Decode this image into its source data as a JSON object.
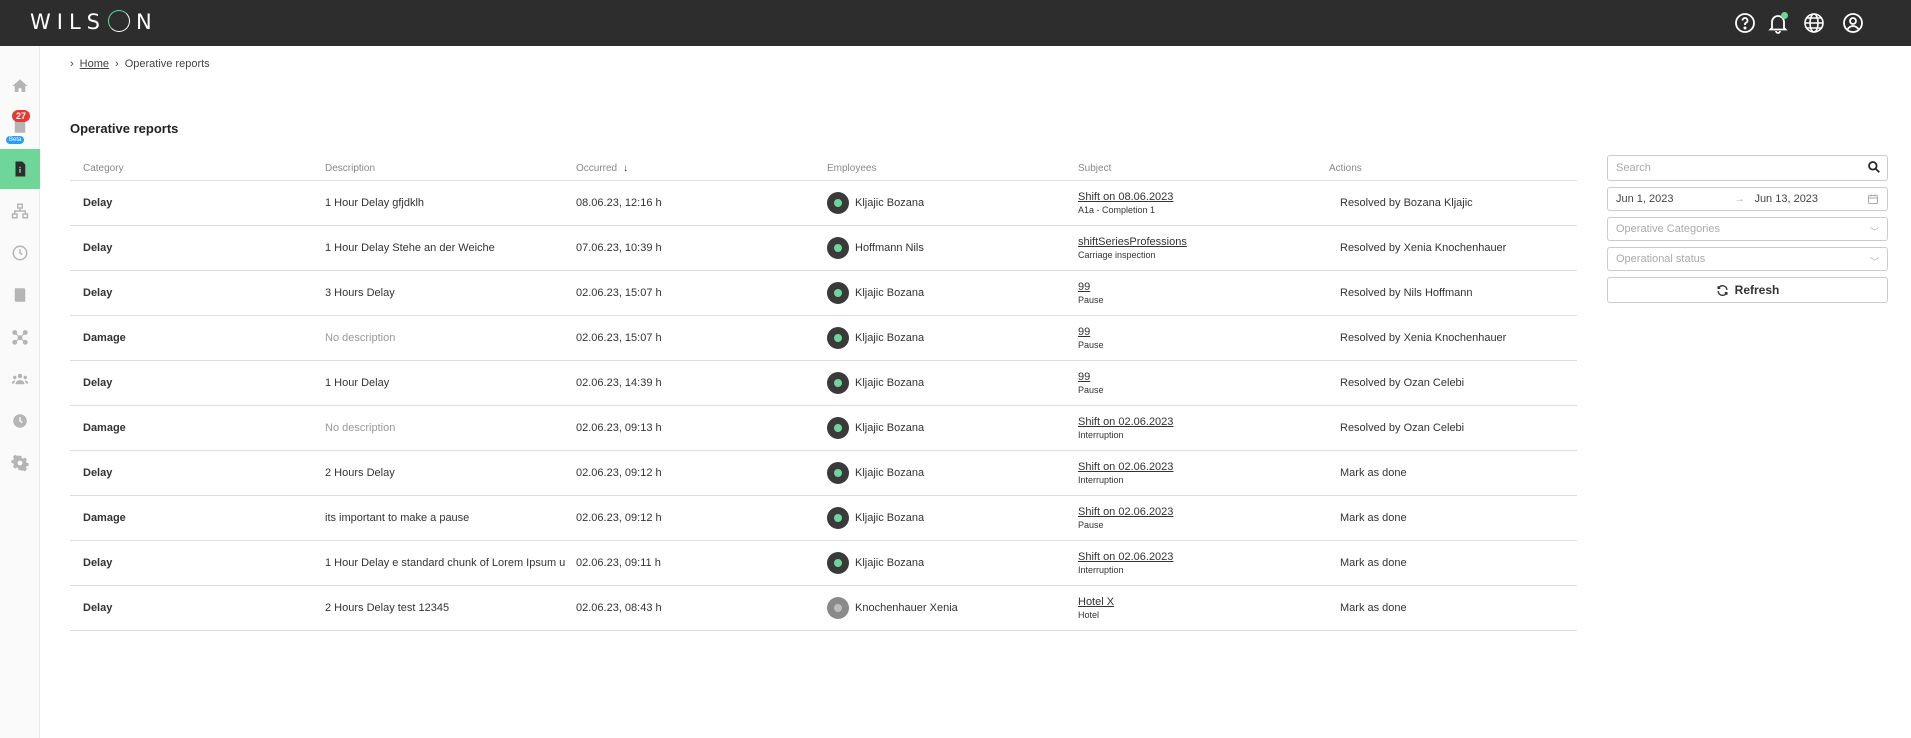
{
  "app": {
    "logo": "WILSON"
  },
  "sidebar": {
    "badge_count": "27",
    "beta_label": "Beta"
  },
  "breadcrumb": {
    "home": "Home",
    "current": "Operative reports"
  },
  "page": {
    "title": "Operative reports"
  },
  "table": {
    "headers": {
      "category": "Category",
      "description": "Description",
      "occurred": "Occurred",
      "employees": "Employees",
      "subject": "Subject",
      "actions": "Actions"
    },
    "rows": [
      {
        "category": "Delay",
        "description": "1 Hour Delay gfjdklh",
        "occurred": "08.06.23, 12:16 h",
        "employee": "Kljajic Bozana",
        "subject": "Shift on 08.06.2023",
        "subject_sub": "A1a - Completion 1",
        "action": "Resolved by Bozana Kljajic"
      },
      {
        "category": "Delay",
        "description": "1 Hour Delay Stehe an der Weiche",
        "occurred": "07.06.23, 10:39 h",
        "employee": "Hoffmann Nils",
        "subject": "shiftSeriesProfessions",
        "subject_sub": "Carriage inspection",
        "action": "Resolved by Xenia Knochenhauer"
      },
      {
        "category": "Delay",
        "description": "3 Hours Delay",
        "occurred": "02.06.23, 15:07 h",
        "employee": "Kljajic Bozana",
        "subject": "99",
        "subject_sub": "Pause",
        "action": "Resolved by Nils Hoffmann"
      },
      {
        "category": "Damage",
        "description": "No description",
        "occurred": "02.06.23, 15:07 h",
        "employee": "Kljajic Bozana",
        "subject": "99",
        "subject_sub": "Pause",
        "action": "Resolved by Xenia Knochenhauer"
      },
      {
        "category": "Delay",
        "description": "1 Hour Delay",
        "occurred": "02.06.23, 14:39 h",
        "employee": "Kljajic Bozana",
        "subject": "99",
        "subject_sub": "Pause",
        "action": "Resolved by Ozan Celebi"
      },
      {
        "category": "Damage",
        "description": "No description",
        "occurred": "02.06.23, 09:13 h",
        "employee": "Kljajic Bozana",
        "subject": "Shift on 02.06.2023",
        "subject_sub": "Interruption",
        "action": "Resolved by Ozan Celebi"
      },
      {
        "category": "Delay",
        "description": "2 Hours Delay",
        "occurred": "02.06.23, 09:12 h",
        "employee": "Kljajic Bozana",
        "subject": "Shift on 02.06.2023",
        "subject_sub": "Interruption",
        "action": "Mark as done"
      },
      {
        "category": "Damage",
        "description": "its important to make a pause",
        "occurred": "02.06.23, 09:12 h",
        "employee": "Kljajic Bozana",
        "subject": "Shift on 02.06.2023",
        "subject_sub": "Pause",
        "action": "Mark as done"
      },
      {
        "category": "Delay",
        "description": "1 Hour Delay e standard chunk of Lorem Ipsum u",
        "occurred": "02.06.23, 09:11 h",
        "employee": "Kljajic Bozana",
        "subject": "Shift on 02.06.2023",
        "subject_sub": "Interruption",
        "action": "Mark as done"
      },
      {
        "category": "Delay",
        "description": "2 Hours Delay test 12345",
        "occurred": "02.06.23, 08:43 h",
        "employee": "Knochenhauer Xenia",
        "subject": "Hotel X",
        "subject_sub": "Hotel",
        "action": "Mark as done"
      }
    ]
  },
  "filters": {
    "search_placeholder": "Search",
    "date_from": "Jun 1, 2023",
    "date_sep": "→",
    "date_to": "Jun 13, 2023",
    "categories_placeholder": "Operative Categories",
    "status_placeholder": "Operational status",
    "refresh_label": "Refresh"
  },
  "colors": {
    "accent": "#6fd69a",
    "topbar": "#2d2d2d",
    "badge": "#e53935",
    "beta": "#2e9cff"
  }
}
